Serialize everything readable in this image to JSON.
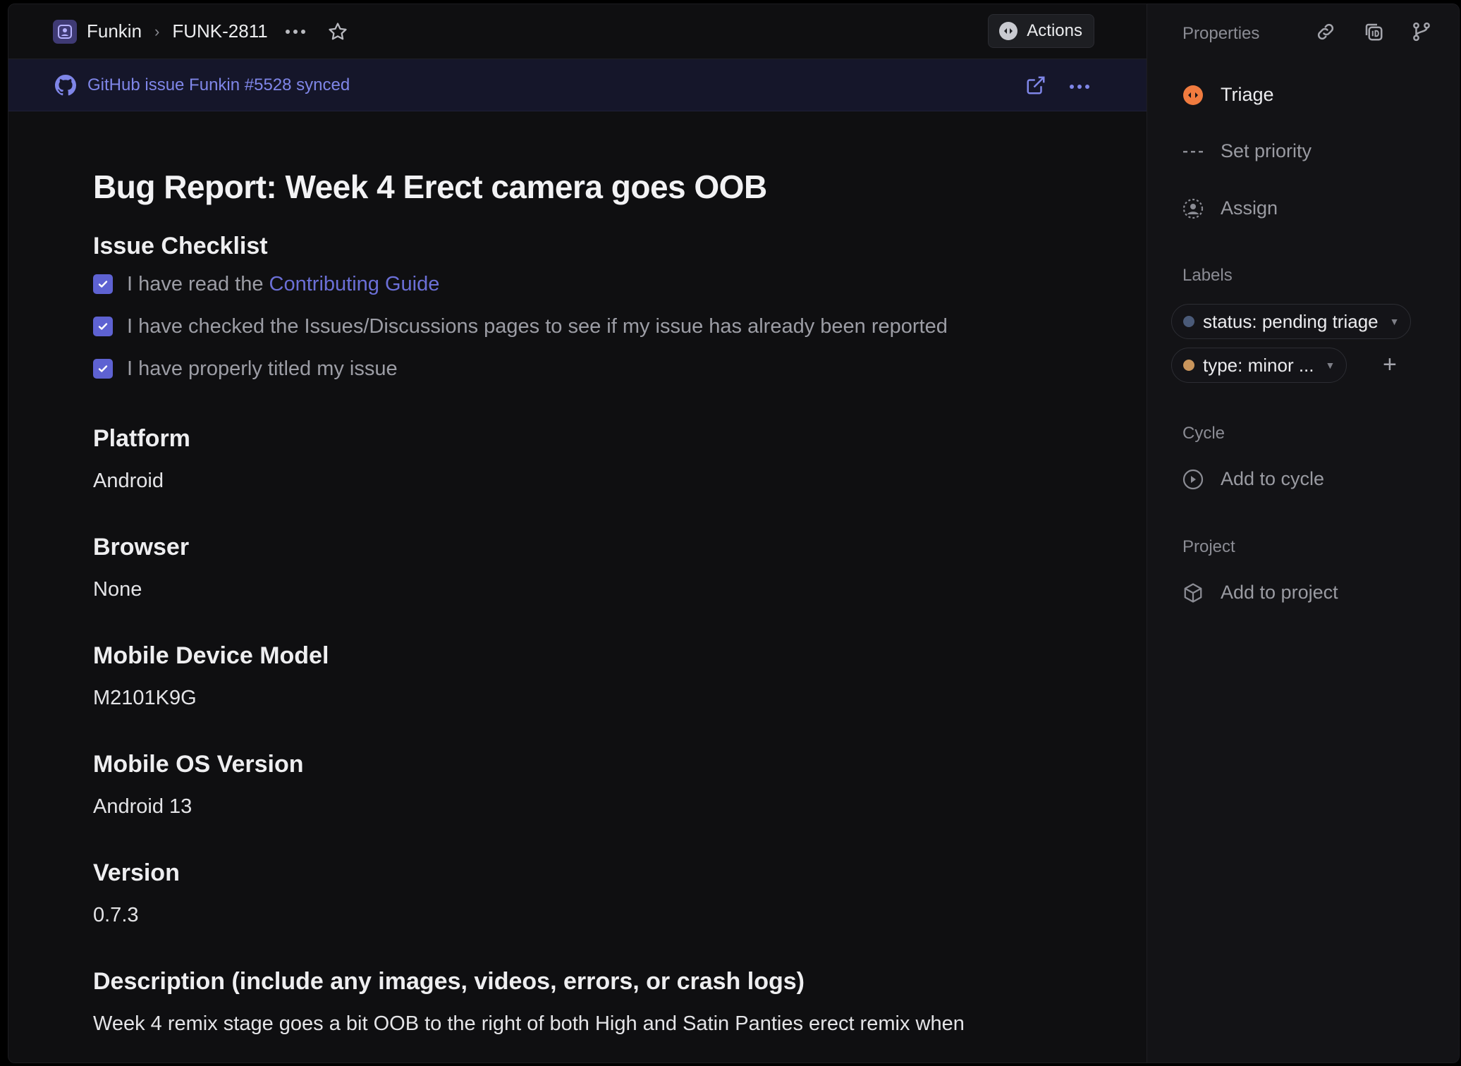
{
  "breadcrumb": {
    "team": "Funkin",
    "issue_id": "FUNK-2811"
  },
  "toolbar": {
    "actions_label": "Actions"
  },
  "sync": {
    "text": "GitHub issue Funkin #5528 synced"
  },
  "issue": {
    "title": "Bug Report: Week 4 Erect camera goes OOB",
    "checklist_heading": "Issue Checklist",
    "checklist": [
      {
        "prefix": "I have read the ",
        "link": "Contributing Guide",
        "checked": true
      },
      {
        "prefix": "I have checked the Issues/Discussions pages to see if my issue has already been reported",
        "checked": true
      },
      {
        "prefix": "I have properly titled my issue",
        "checked": true
      }
    ],
    "fields": [
      {
        "heading": "Platform",
        "value": "Android"
      },
      {
        "heading": "Browser",
        "value": "None"
      },
      {
        "heading": "Mobile Device Model",
        "value": "M2101K9G"
      },
      {
        "heading": "Mobile OS Version",
        "value": "Android 13"
      },
      {
        "heading": "Version",
        "value": "0.7.3"
      }
    ],
    "description_heading": "Description (include any images, videos, errors, or crash logs)",
    "description": "Week 4 remix stage goes a bit OOB to the right of both High and Satin Panties erect remix when"
  },
  "sidebar": {
    "header": "Properties",
    "status": "Triage",
    "priority": "Set priority",
    "assignee": "Assign",
    "labels_title": "Labels",
    "labels": [
      {
        "text": "status: pending triage",
        "color": "#4a5a78"
      },
      {
        "text": "type: minor ...",
        "color": "#c9955c"
      }
    ],
    "cycle_title": "Cycle",
    "cycle_action": "Add to cycle",
    "project_title": "Project",
    "project_action": "Add to project"
  },
  "colors": {
    "accent": "#5e62d2",
    "triage": "#f07b3f",
    "link": "#6b6fd6"
  }
}
